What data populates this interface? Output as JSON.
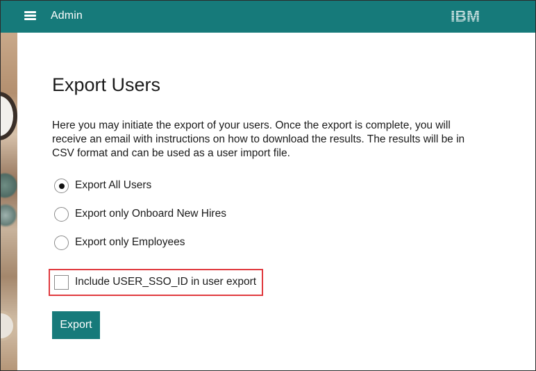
{
  "header": {
    "menu_icon": "hamburger-menu-icon",
    "title": "Admin",
    "logo_text": "IBM",
    "background_color": "#167a7a"
  },
  "main": {
    "title": "Export Users",
    "description": "Here you may initiate the export of your users. Once the export is complete, you will receive an email with instructions on how to download the results. The results will be in CSV format and can be used as a user import file.",
    "options": [
      {
        "label": "Export All Users",
        "selected": true
      },
      {
        "label": "Export only Onboard New Hires",
        "selected": false
      },
      {
        "label": "Export only Employees",
        "selected": false
      }
    ],
    "checkbox": {
      "label": "Include USER_SSO_ID in user export",
      "checked": false
    },
    "export_button": "Export"
  },
  "colors": {
    "accent": "#167a7a",
    "highlight": "#e0393e"
  }
}
